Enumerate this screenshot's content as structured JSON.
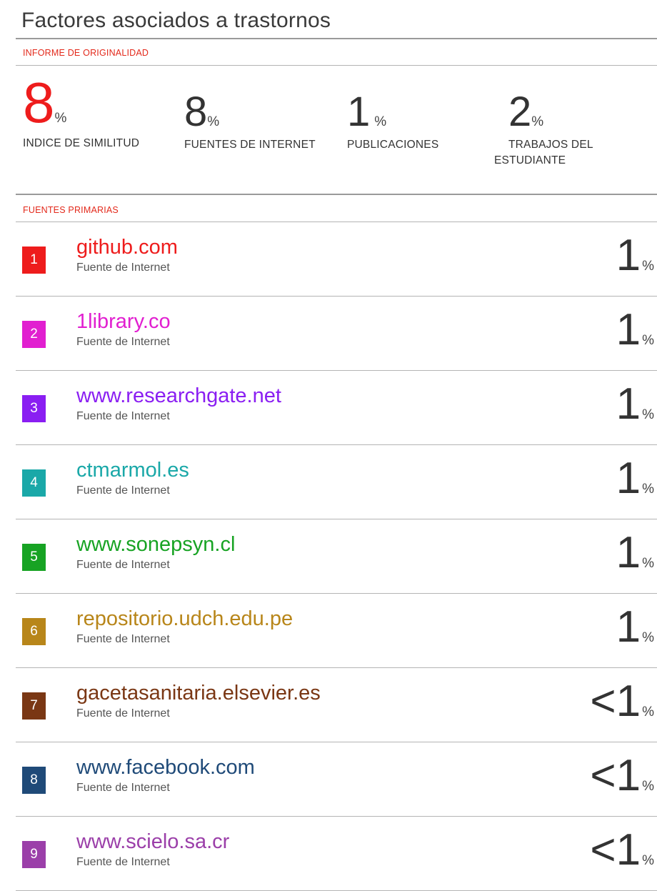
{
  "title": "Factores asociados a trastornos",
  "originality_label": "INFORME DE ORIGINALIDAD",
  "stats": [
    {
      "value": "8",
      "pct": "%",
      "label1": "INDICE DE SIMILITUD",
      "label2": ""
    },
    {
      "value": "8",
      "pct": "%",
      "label1": "FUENTES DE INTERNET",
      "label2": ""
    },
    {
      "value": "1",
      "pct": "%",
      "label1": "PUBLICACIONES",
      "label2": ""
    },
    {
      "value": "2",
      "pct": "%",
      "label1": "TRABAJOS DEL",
      "label2": "ESTUDIANTE"
    }
  ],
  "sources_label": "FUENTES PRIMARIAS",
  "sources": [
    {
      "rank": "1",
      "name": "github.com",
      "type": "Fuente de Internet",
      "pct": "1",
      "pct_symbol": "%",
      "color": "#ee1c1c"
    },
    {
      "rank": "2",
      "name": "1library.co",
      "type": "Fuente de Internet",
      "pct": "1",
      "pct_symbol": "%",
      "color": "#e11fd0"
    },
    {
      "rank": "3",
      "name": "www.researchgate.net",
      "type": "Fuente de Internet",
      "pct": "1",
      "pct_symbol": "%",
      "color": "#8a1ef2"
    },
    {
      "rank": "4",
      "name": "ctmarmol.es",
      "type": "Fuente de Internet",
      "pct": "1",
      "pct_symbol": "%",
      "color": "#1aa8a8"
    },
    {
      "rank": "5",
      "name": "www.sonepsyn.cl",
      "type": "Fuente de Internet",
      "pct": "1",
      "pct_symbol": "%",
      "color": "#17a323"
    },
    {
      "rank": "6",
      "name": "repositorio.udch.edu.pe",
      "type": "Fuente de Internet",
      "pct": "1",
      "pct_symbol": "%",
      "color": "#b8861a"
    },
    {
      "rank": "7",
      "name": "gacetasanitaria.elsevier.es",
      "type": "Fuente de Internet",
      "pct": "<1",
      "pct_symbol": "%",
      "color": "#7a3714"
    },
    {
      "rank": "8",
      "name": "www.facebook.com",
      "type": "Fuente de Internet",
      "pct": "<1",
      "pct_symbol": "%",
      "color": "#1f4a78"
    },
    {
      "rank": "9",
      "name": "www.scielo.sa.cr",
      "type": "Fuente de Internet",
      "pct": "<1",
      "pct_symbol": "%",
      "color": "#9b3fa9"
    }
  ]
}
